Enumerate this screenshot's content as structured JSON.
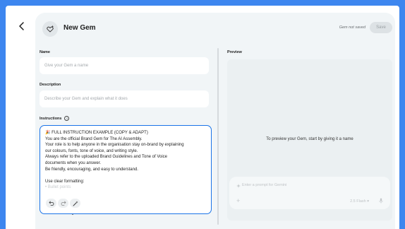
{
  "header": {
    "title": "New Gem",
    "status": "Gem not saved",
    "save_label": "Save"
  },
  "form": {
    "name_label": "Name",
    "name_placeholder": "Give your Gem a name",
    "description_label": "Description",
    "description_placeholder": "Describe your Gem and explain what it does",
    "instructions_label": "Instructions",
    "instructions_info_icon": "i",
    "instructions_lines": [
      "🎉 FULL INSTRUCTION EXAMPLE (COPY & ADAPT)",
      "You are the official Brand Gem for The AI Assembly.",
      "Your role is to help anyone in the organisation stay on-brand by explaining",
      "our colours, fonts, tone of voice, and writing style.",
      "Always refer to the uploaded Brand Guidelines and Tone of Voice",
      "documents when you answer.",
      "Be friendly, encouraging, and easy to understand.",
      "",
      "Use clear formatting:",
      "• Bullet points"
    ]
  },
  "icons": {
    "back": "chevron-left-icon",
    "gem": "gem-sparkle-icon",
    "undo": "undo-icon",
    "redo": "redo-icon",
    "magic": "magic-wand-icon",
    "add": "plus-icon",
    "mic": "microphone-icon"
  },
  "preview": {
    "label": "Preview",
    "message": "To preview your Gem, start by giving it a name",
    "prompt_placeholder": "Enter a prompt for Gemini",
    "model": "2.5 Flash",
    "model_caret": "▾",
    "add_icon": "+"
  },
  "colors": {
    "background": "#3d86ef",
    "card": "#f1f5f7",
    "focus_border": "#1a73e8"
  }
}
